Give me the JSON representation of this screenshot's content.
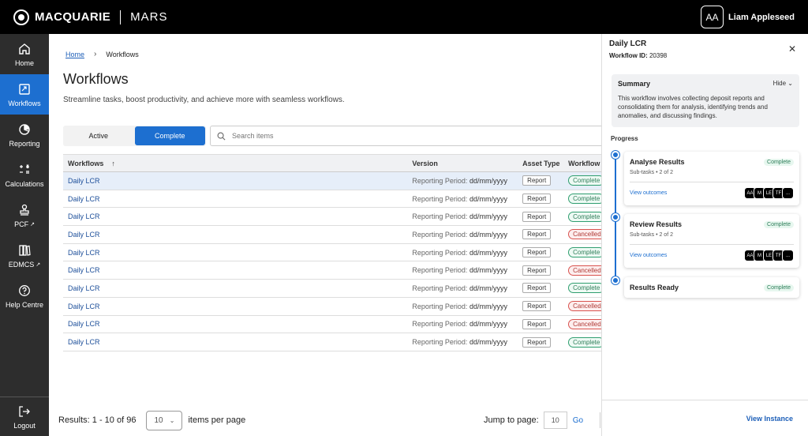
{
  "header": {
    "brand": "MACQUARIE",
    "app_name": "MARS",
    "user_initials": "AA",
    "user_name": "Liam Appleseed"
  },
  "sidebar": {
    "items": [
      {
        "label": "Home",
        "icon": "home-icon"
      },
      {
        "label": "Workflows",
        "icon": "workflow-icon",
        "active": true
      },
      {
        "label": "Reporting",
        "icon": "pie-chart-icon"
      },
      {
        "label": "Calculations",
        "icon": "calculator-icon"
      },
      {
        "label": "PCF",
        "icon": "stamp-icon",
        "external": true
      },
      {
        "label": "EDMCS",
        "icon": "books-icon",
        "external": true
      },
      {
        "label": "Help Centre",
        "icon": "help-icon"
      }
    ],
    "logout": "Logout"
  },
  "breadcrumb": {
    "home": "Home",
    "current": "Workflows"
  },
  "page": {
    "title": "Workflows",
    "subtitle": "Streamline tasks, boost productivity, and achieve more with seamless workflows."
  },
  "tabs": {
    "active": "Active",
    "complete": "Complete"
  },
  "search": {
    "placeholder": "Search items"
  },
  "table": {
    "headers": {
      "workflows": "Workflows",
      "version": "Version",
      "asset_type": "Asset Type",
      "workflow_status": "Workflow"
    },
    "rows": [
      {
        "name": "Daily LCR",
        "version_prefix": "Reporting Period:",
        "version_value": "dd/mm/yyyy",
        "asset": "Report",
        "status": "Complete"
      },
      {
        "name": "Daily LCR",
        "version_prefix": "Reporting Period:",
        "version_value": "dd/mm/yyyy",
        "asset": "Report",
        "status": "Complete"
      },
      {
        "name": "Daily LCR",
        "version_prefix": "Reporting Period:",
        "version_value": "dd/mm/yyyy",
        "asset": "Report",
        "status": "Complete"
      },
      {
        "name": "Daily LCR",
        "version_prefix": "Reporting Period:",
        "version_value": "dd/mm/yyyy",
        "asset": "Report",
        "status": "Cancelled"
      },
      {
        "name": "Daily LCR",
        "version_prefix": "Reporting Period:",
        "version_value": "dd/mm/yyyy",
        "asset": "Report",
        "status": "Complete"
      },
      {
        "name": "Daily LCR",
        "version_prefix": "Reporting Period:",
        "version_value": "dd/mm/yyyy",
        "asset": "Report",
        "status": "Cancelled"
      },
      {
        "name": "Daily LCR",
        "version_prefix": "Reporting Period:",
        "version_value": "dd/mm/yyyy",
        "asset": "Report",
        "status": "Complete"
      },
      {
        "name": "Daily LCR",
        "version_prefix": "Reporting Period:",
        "version_value": "dd/mm/yyyy",
        "asset": "Report",
        "status": "Cancelled"
      },
      {
        "name": "Daily LCR",
        "version_prefix": "Reporting Period:",
        "version_value": "dd/mm/yyyy",
        "asset": "Report",
        "status": "Cancelled"
      },
      {
        "name": "Daily LCR",
        "version_prefix": "Reporting Period:",
        "version_value": "dd/mm/yyyy",
        "asset": "Report",
        "status": "Complete"
      }
    ]
  },
  "footer": {
    "results": "Results: 1 - 10 of 96",
    "per_page_value": "10",
    "per_page_label": "items per page",
    "jump_label": "Jump to page:",
    "jump_value": "10",
    "go": "Go"
  },
  "panel": {
    "title": "Daily LCR",
    "id_label": "Workflow ID:",
    "id_value": "20398",
    "summary_title": "Summary",
    "hide_label": "Hide",
    "summary_text": "This workflow involves collecting deposit reports and consolidating them for analysis, identifying trends and anomalies, and discussing findings.",
    "progress_label": "Progress",
    "steps": [
      {
        "title": "Analyse Results",
        "status": "Complete",
        "subtasks": "Sub-tasks • 2 of 2",
        "link": "View outcomes",
        "avatars": [
          "AA",
          "M",
          "LE",
          "TF",
          "..."
        ]
      },
      {
        "title": "Review Results",
        "status": "Complete",
        "subtasks": "Sub-tasks • 2 of 2",
        "link": "View outcomes",
        "avatars": [
          "AA",
          "M",
          "LE",
          "TF",
          "..."
        ]
      },
      {
        "title": "Results Ready",
        "status": "Complete"
      }
    ],
    "view_instance": "View Instance"
  },
  "colors": {
    "accent": "#1d6fd0",
    "topbar": "#000000",
    "sidebar": "#2d2d2d",
    "complete": "#2f9e6f",
    "cancelled": "#d9534f"
  }
}
